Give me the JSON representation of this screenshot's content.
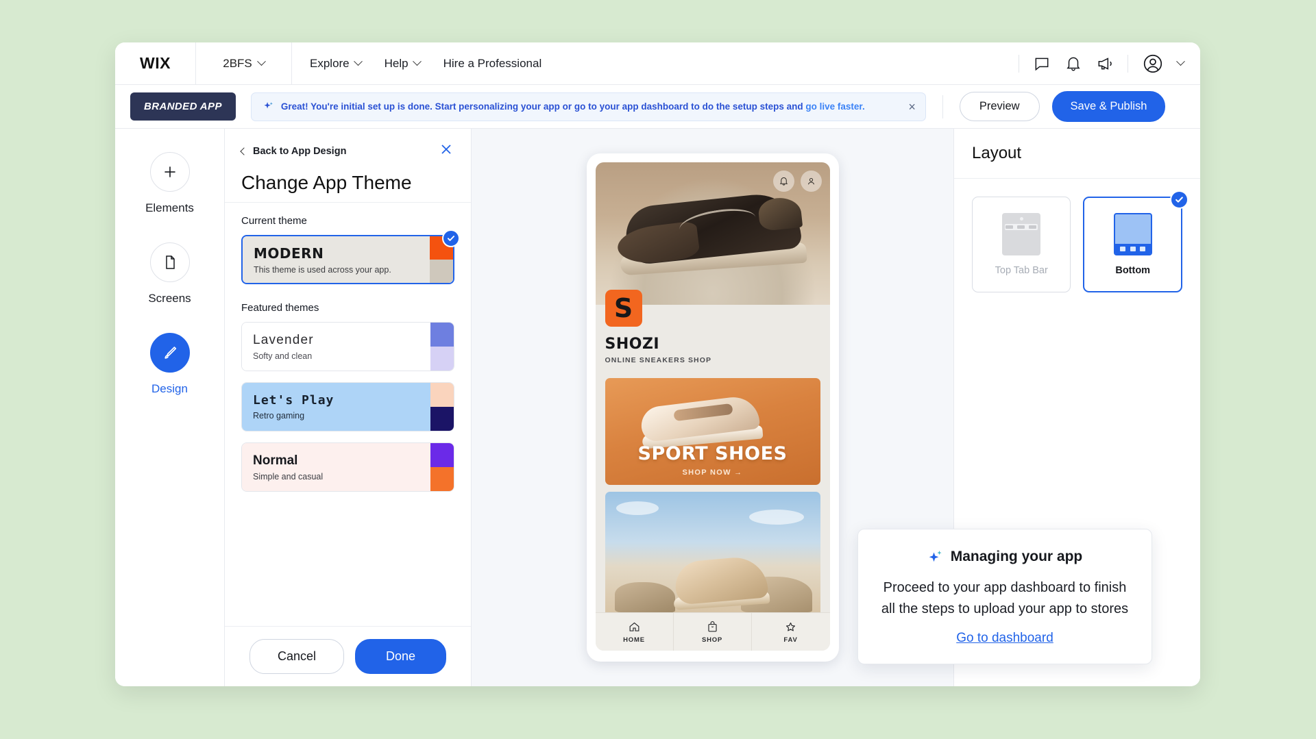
{
  "topbar": {
    "logo": "WIX",
    "site_name": "2BFS",
    "menu": [
      {
        "label": "Explore",
        "has_caret": true
      },
      {
        "label": "Help",
        "has_caret": true
      },
      {
        "label": "Hire a Professional",
        "has_caret": false
      }
    ],
    "icons": [
      "chat-icon",
      "bell-icon",
      "megaphone-icon",
      "account-icon",
      "chevron-down-icon"
    ]
  },
  "subbar": {
    "badge": "BRANDED APP",
    "banner": {
      "text_before": "Great! You're initial set up is done. Start personalizing your app or go to your app dashboard to do the setup  steps and ",
      "link": "go live faster.",
      "close": "×"
    },
    "preview_label": "Preview",
    "publish_label": "Save & Publish"
  },
  "rail": {
    "items": [
      {
        "label": "Elements",
        "icon": "plus-icon",
        "active": false
      },
      {
        "label": "Screens",
        "icon": "page-icon",
        "active": false
      },
      {
        "label": "Design",
        "icon": "brush-icon",
        "active": true
      }
    ]
  },
  "panel": {
    "back_label": "Back to App Design",
    "title": "Change App Theme",
    "current_label": "Current theme",
    "featured_label": "Featured themes",
    "current_theme": {
      "name": "MODERN",
      "desc": "This theme is used across your app.",
      "swatch_top": "#f4520f",
      "swatch_bottom": "#cfc8bc",
      "selected": true
    },
    "featured": [
      {
        "name": "Lavender",
        "desc": "Softy and clean",
        "swatch_top": "#6e7fe0",
        "swatch_bottom": "#d6d1f5",
        "selected": false
      },
      {
        "name": "Let's Play",
        "desc": "Retro gaming",
        "swatch_top": "#fad4bd",
        "swatch_bottom": "#1b1466",
        "selected": false
      },
      {
        "name": "Normal",
        "desc": "Simple and casual",
        "swatch_top": "#6b2ae8",
        "swatch_bottom": "#f4722a",
        "selected": false
      }
    ],
    "cancel_label": "Cancel",
    "done_label": "Done"
  },
  "phone_preview": {
    "brand_logo_letter": "S",
    "brand_name": "SHOZI",
    "brand_tagline": "ONLINE SNEAKERS SHOP",
    "promo_title": "SPORT SHOES",
    "promo_sub": "SHOP NOW →",
    "hero_icons": [
      "bell-icon",
      "account-icon"
    ],
    "tabs": [
      {
        "label": "HOME",
        "icon": "home-icon"
      },
      {
        "label": "SHOP",
        "icon": "bag-icon"
      },
      {
        "label": "FAV",
        "icon": "star-icon"
      }
    ]
  },
  "right_panel": {
    "title": "Layout",
    "options": [
      {
        "label": "Top Tab Bar",
        "selected": false
      },
      {
        "label": "Bottom",
        "selected": true
      }
    ]
  },
  "tooltip": {
    "heading": "Managing your app",
    "body": "Proceed to your app dashboard to finish all the steps to upload your app to stores",
    "link": "Go to dashboard"
  },
  "colors": {
    "accent": "#2163e8",
    "banner_text": "#2a51d4",
    "badge_bg": "#2d3556",
    "canvas_bg": "#f5f7fa",
    "page_bg": "#d7ead0"
  }
}
